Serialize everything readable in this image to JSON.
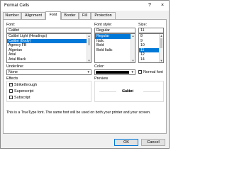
{
  "window": {
    "title": "Format Cells",
    "help_glyph": "?",
    "close_glyph": "×"
  },
  "tabs": [
    "Number",
    "Alignment",
    "Font",
    "Border",
    "Fill",
    "Protection"
  ],
  "active_tab": "Font",
  "font": {
    "label": "Font:",
    "value": "Calibri",
    "items": [
      "Calibri Light (Headings)",
      "Calibri (Body)",
      "Agency FB",
      "Algerian",
      "Arial",
      "Arial Black"
    ],
    "selected_index": 1
  },
  "font_style": {
    "label": "Font style:",
    "value": "Regular",
    "items": [
      "Regular",
      "Italic",
      "Bold",
      "Bold Italic"
    ],
    "selected_index": 0
  },
  "size": {
    "label": "Size:",
    "value": "11",
    "items": [
      "8",
      "9",
      "10",
      "11",
      "12",
      "14"
    ],
    "selected_index": 3
  },
  "underline": {
    "label": "Underline:",
    "value": "None"
  },
  "color": {
    "label": "Color:",
    "swatch": "#000000"
  },
  "normal_font": {
    "label": "Normal font",
    "checked": false
  },
  "effects": {
    "label": "Effects",
    "strikethrough": {
      "label": "Strikethrough",
      "checked": true
    },
    "superscript": {
      "label": "Superscript",
      "checked": false
    },
    "subscript": {
      "label": "Subscript",
      "checked": false
    }
  },
  "preview": {
    "label": "Preview",
    "text": "Calibri"
  },
  "info_text": "This is a TrueType font.  The same font will be used on both your printer and your screen.",
  "buttons": {
    "ok": "OK",
    "cancel": "Cancel"
  },
  "colors": {
    "selection": "#0078d7"
  }
}
